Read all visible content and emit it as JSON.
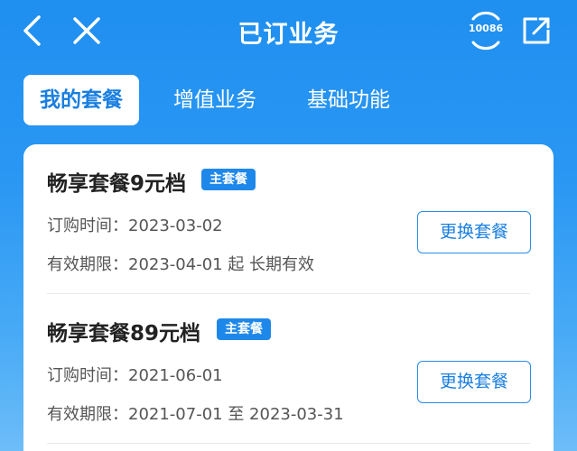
{
  "header": {
    "title": "已订业务",
    "hotline": "10086"
  },
  "tabs": [
    {
      "label": "我的套餐",
      "active": true
    },
    {
      "label": "增值业务",
      "active": false
    },
    {
      "label": "基础功能",
      "active": false
    }
  ],
  "packages": [
    {
      "name": "畅享套餐9元档",
      "badge": "主套餐",
      "purchase_label": "订购时间：",
      "purchase_date": "2023-03-02",
      "validity_label": "有效期限：",
      "validity": "2023-04-01 起 长期有效",
      "button": "更换套餐"
    },
    {
      "name": "畅享套餐89元档",
      "badge": "主套餐",
      "purchase_label": "订购时间：",
      "purchase_date": "2021-06-01",
      "validity_label": "有效期限：",
      "validity": "2021-07-01 至 2023-03-31",
      "button": "更换套餐"
    }
  ],
  "colors": {
    "accent": "#1e88ea",
    "header_bg": "#1f8ff0"
  },
  "icons": [
    "back-icon",
    "close-icon",
    "hotline-icon",
    "share-icon"
  ]
}
